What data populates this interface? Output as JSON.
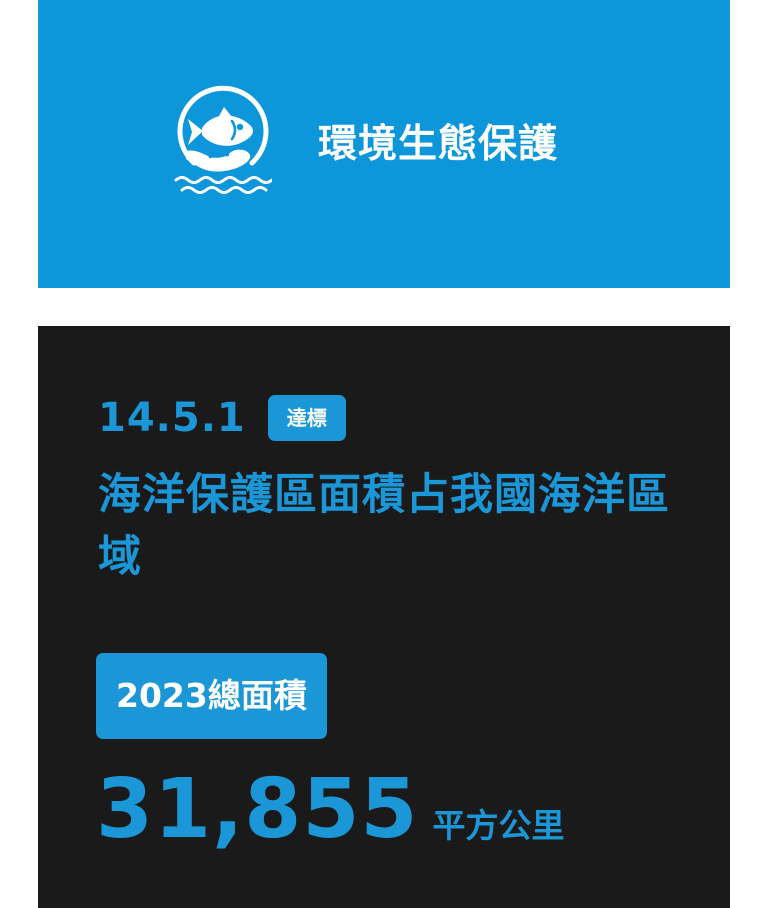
{
  "header": {
    "title": "環境生態保護",
    "icon": "fish-in-hand-icon",
    "background_color": "#0d96d9"
  },
  "indicator": {
    "code": "14.5.1",
    "status_badge": "達標",
    "title": "海洋保護區面積占我國海洋區域",
    "metric_label": "2023總面積",
    "metric_value": "31,855",
    "metric_unit": "平方公里",
    "accent_color": "#1b96d6",
    "card_background": "#1a1a1a"
  }
}
